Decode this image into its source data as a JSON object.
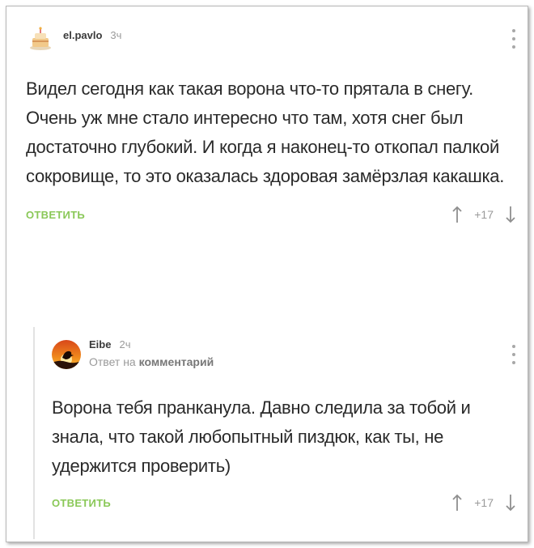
{
  "comments": [
    {
      "author": "el.pavlo",
      "time": "3ч",
      "text": "Видел сегодня как такая ворона что-то прятала в снегу. Очень уж мне стало интересно что там, хотя снег был достаточно глубокий. И когда я наконец-то откопал палкой сокровище, то это оказалась здоровая замёрзлая какашка.",
      "reply_label": "ОТВЕТИТЬ",
      "rating": "+17"
    },
    {
      "author": "Eibe",
      "time": "2ч",
      "reply_to_prefix": "Ответ на",
      "reply_to_link": "комментарий",
      "text": "Ворона тебя пранканула. Давно следила за тобой и знала, что такой любопытный пиздюк, как ты, не удержится проверить)",
      "reply_label": "ОТВЕТИТЬ",
      "rating": "+17"
    }
  ],
  "colors": {
    "reply_button": "#8ac858",
    "muted": "#9a9a9a",
    "text": "#2a2a2a"
  },
  "icons": [
    "avatar-cake-icon",
    "avatar-sunset-bird-icon",
    "more-icon",
    "upvote-icon",
    "downvote-icon"
  ]
}
